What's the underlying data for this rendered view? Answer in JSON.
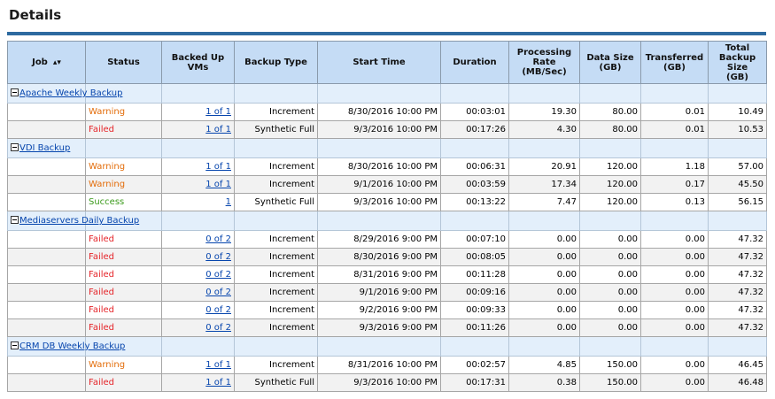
{
  "title": "Details",
  "columns": {
    "job": "Job",
    "status": "Status",
    "backed_up_vms": "Backed Up VMs",
    "backup_type": "Backup Type",
    "start_time": "Start Time",
    "duration": "Duration",
    "rate": [
      "Processing",
      "Rate",
      "(MB/Sec)"
    ],
    "data_size": [
      "Data Size",
      "(GB)"
    ],
    "transferred": [
      "Transferred",
      "(GB)"
    ],
    "total": [
      "Total",
      "Backup Size",
      "(GB)"
    ]
  },
  "sort_icon": "sort-updown-icon",
  "colors": {
    "header_bg": "#c5dcf5",
    "group_bg": "#e3effb",
    "warning": "#e36c09",
    "failed": "#e5252a",
    "success": "#3a9a1a",
    "rule": "#2d6aa0"
  },
  "groups": [
    {
      "name": "Apache Weekly Backup",
      "rows": [
        {
          "status": "Warning",
          "vms": "1 of 1",
          "type": "Increment",
          "start": "8/30/2016 10:00 PM",
          "duration": "00:03:01",
          "rate": "19.30",
          "size": "80.00",
          "transferred": "0.01",
          "total": "10.49"
        },
        {
          "status": "Failed",
          "vms": "1 of 1",
          "type": "Synthetic Full",
          "start": "9/3/2016 10:00 PM",
          "duration": "00:17:26",
          "rate": "4.30",
          "size": "80.00",
          "transferred": "0.01",
          "total": "10.53"
        }
      ]
    },
    {
      "name": "VDI Backup",
      "rows": [
        {
          "status": "Warning",
          "vms": "1 of 1",
          "type": "Increment",
          "start": "8/30/2016 10:00 PM",
          "duration": "00:06:31",
          "rate": "20.91",
          "size": "120.00",
          "transferred": "1.18",
          "total": "57.00"
        },
        {
          "status": "Warning",
          "vms": "1 of 1",
          "type": "Increment",
          "start": "9/1/2016 10:00 PM",
          "duration": "00:03:59",
          "rate": "17.34",
          "size": "120.00",
          "transferred": "0.17",
          "total": "45.50"
        },
        {
          "status": "Success",
          "vms": "1",
          "type": "Synthetic Full",
          "start": "9/3/2016 10:00 PM",
          "duration": "00:13:22",
          "rate": "7.47",
          "size": "120.00",
          "transferred": "0.13",
          "total": "56.15"
        }
      ]
    },
    {
      "name": "Mediaservers Daily Backup",
      "rows": [
        {
          "status": "Failed",
          "vms": "0 of 2",
          "type": "Increment",
          "start": "8/29/2016 9:00 PM",
          "duration": "00:07:10",
          "rate": "0.00",
          "size": "0.00",
          "transferred": "0.00",
          "total": "47.32"
        },
        {
          "status": "Failed",
          "vms": "0 of 2",
          "type": "Increment",
          "start": "8/30/2016 9:00 PM",
          "duration": "00:08:05",
          "rate": "0.00",
          "size": "0.00",
          "transferred": "0.00",
          "total": "47.32"
        },
        {
          "status": "Failed",
          "vms": "0 of 2",
          "type": "Increment",
          "start": "8/31/2016 9:00 PM",
          "duration": "00:11:28",
          "rate": "0.00",
          "size": "0.00",
          "transferred": "0.00",
          "total": "47.32"
        },
        {
          "status": "Failed",
          "vms": "0 of 2",
          "type": "Increment",
          "start": "9/1/2016 9:00 PM",
          "duration": "00:09:16",
          "rate": "0.00",
          "size": "0.00",
          "transferred": "0.00",
          "total": "47.32"
        },
        {
          "status": "Failed",
          "vms": "0 of 2",
          "type": "Increment",
          "start": "9/2/2016 9:00 PM",
          "duration": "00:09:33",
          "rate": "0.00",
          "size": "0.00",
          "transferred": "0.00",
          "total": "47.32"
        },
        {
          "status": "Failed",
          "vms": "0 of 2",
          "type": "Increment",
          "start": "9/3/2016 9:00 PM",
          "duration": "00:11:26",
          "rate": "0.00",
          "size": "0.00",
          "transferred": "0.00",
          "total": "47.32"
        }
      ]
    },
    {
      "name": "CRM DB Weekly Backup",
      "rows": [
        {
          "status": "Warning",
          "vms": "1 of 1",
          "type": "Increment",
          "start": "8/31/2016 10:00 PM",
          "duration": "00:02:57",
          "rate": "4.85",
          "size": "150.00",
          "transferred": "0.00",
          "total": "46.45"
        },
        {
          "status": "Failed",
          "vms": "1 of 1",
          "type": "Synthetic Full",
          "start": "9/3/2016 10:00 PM",
          "duration": "00:17:31",
          "rate": "0.38",
          "size": "150.00",
          "transferred": "0.00",
          "total": "46.48"
        }
      ]
    }
  ]
}
